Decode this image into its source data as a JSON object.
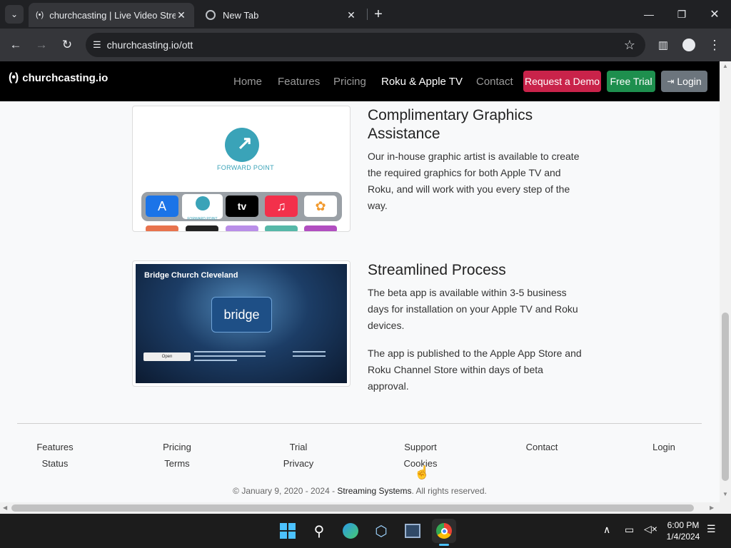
{
  "browser": {
    "tabs": [
      {
        "title": "churchcasting | Live Video Strea",
        "active": true
      },
      {
        "title": "New Tab",
        "active": false
      }
    ],
    "url": "churchcasting.io/ott"
  },
  "site": {
    "brand": "churchcasting.io",
    "nav": {
      "home": "Home",
      "features": "Features",
      "pricing": "Pricing",
      "roku": "Roku & Apple TV",
      "contact": "Contact",
      "demo": "Request a Demo",
      "trial": "Free Trial",
      "login": "Login"
    },
    "colors": {
      "demo": "#c9234a",
      "trial": "#1e8f4e",
      "login": "#6c757d"
    }
  },
  "sections": {
    "graphics": {
      "title": "Complimentary Graphics Assistance",
      "body": "Our in-house graphic artist is available to create the required graphics for both Apple TV and Roku, and will work with you every step of the way.",
      "image_logo_text": "FORWARD POINT",
      "image_tile_text": "FORWARD POINT",
      "appletv_text": "tv"
    },
    "process": {
      "title": "Streamlined Process",
      "body1": "The beta app is available within 3-5 business days for installation on your Apple TV and Roku devices.",
      "body2": "The app is published to the Apple App Store and Roku Channel Store within days of beta approval.",
      "image_title": "Bridge Church Cleveland",
      "image_logo": "bridge",
      "image_button": "Open"
    }
  },
  "footer": {
    "row1": [
      "Features",
      "Pricing",
      "Trial",
      "Support",
      "Contact",
      "Login"
    ],
    "row2": [
      "Status",
      "Terms",
      "Privacy",
      "Cookies"
    ],
    "copyright_prefix": "© January 9, 2020 - 2024 - ",
    "copyright_link": "Streaming Systems",
    "copyright_suffix": ". All rights reserved."
  },
  "taskbar": {
    "time": "6:00 PM",
    "date": "1/4/2024"
  }
}
